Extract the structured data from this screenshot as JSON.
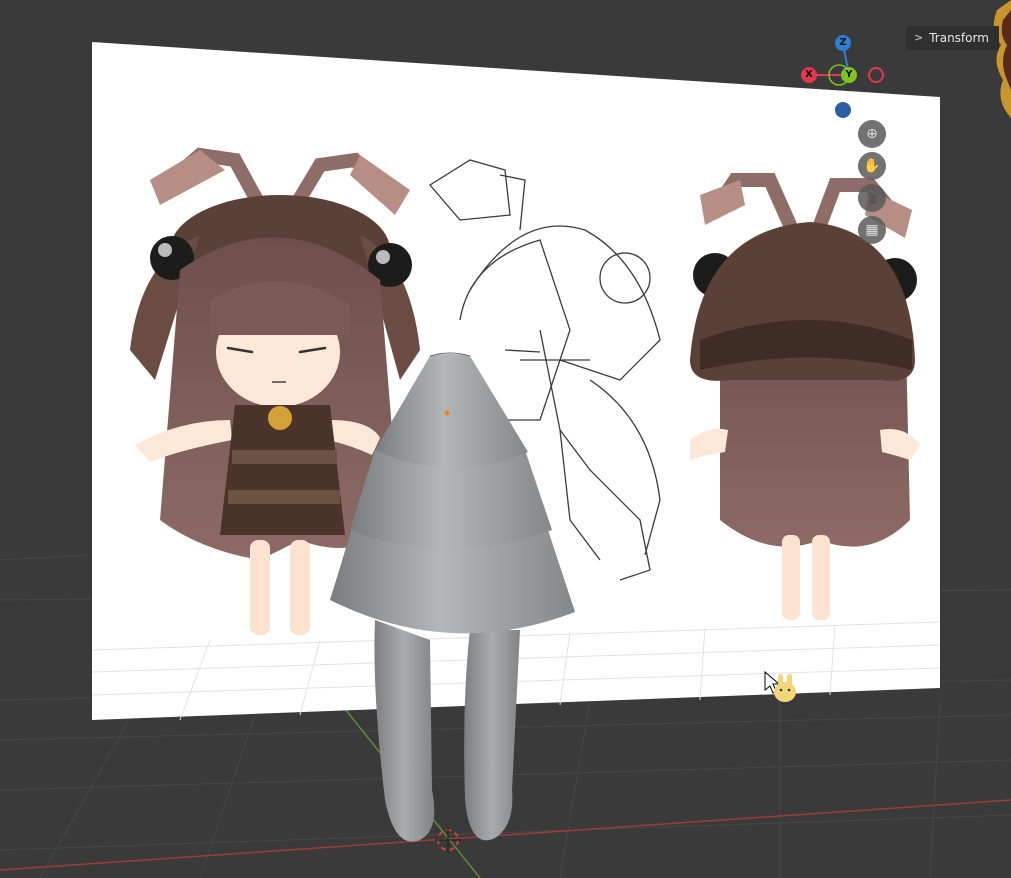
{
  "header": {
    "panel_tab_label": "Transform"
  },
  "gizmo": {
    "z_label": "Z",
    "x_label": "X",
    "y_label": "Y",
    "colors": {
      "x": "#e0384d",
      "y": "#7ec324",
      "z": "#2e7fd8",
      "neg": "#4a6aa0"
    }
  },
  "navigation_tools": [
    {
      "name": "zoom-icon",
      "glyph": "⊕"
    },
    {
      "name": "hand-pan-icon",
      "glyph": "✋"
    },
    {
      "name": "camera-view-icon",
      "glyph": "🎥"
    },
    {
      "name": "grid-view-icon",
      "glyph": "▦"
    }
  ],
  "colors": {
    "viewport_bg": "#3a3a3a",
    "reference_bg": "#ffffff",
    "mesh": "#9fa2a4",
    "hair": "#7b5a57",
    "helmet": "#5d4338"
  }
}
